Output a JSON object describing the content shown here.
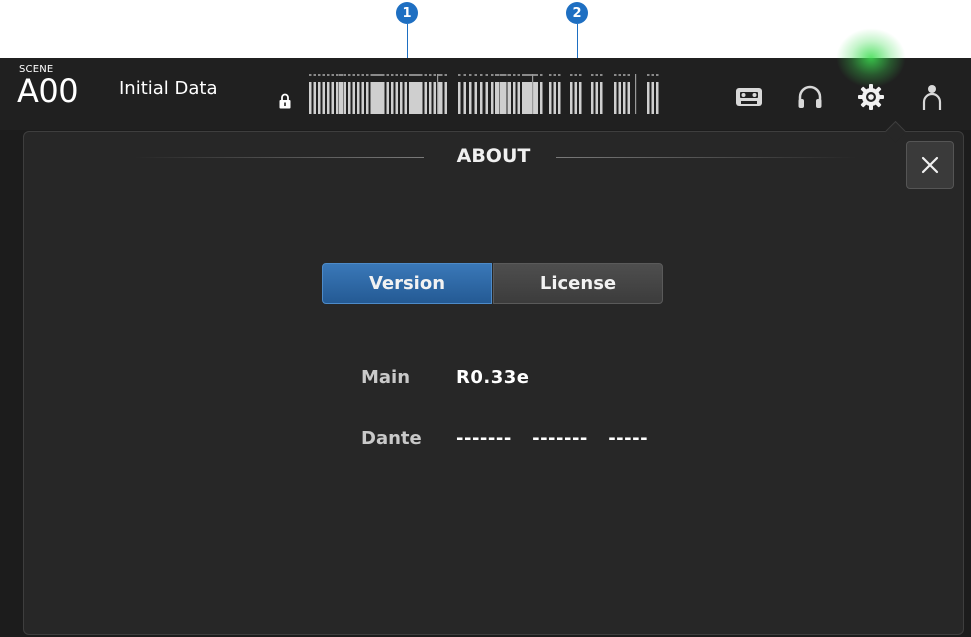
{
  "callouts": [
    "1",
    "2"
  ],
  "header": {
    "scene_label": "SCENE",
    "scene_number": "A00",
    "scene_name": "Initial Data"
  },
  "icons": {
    "lock": "lock-icon",
    "recorder": "recorder-icon",
    "headphones": "headphones-icon",
    "setup": "gear-icon",
    "user": "user-icon"
  },
  "dialog": {
    "title": "ABOUT",
    "close_label": "×",
    "tabs": [
      {
        "label": "Version",
        "active": true
      },
      {
        "label": "License",
        "active": false
      }
    ],
    "info": [
      {
        "label": "Main",
        "value": "R0.33e"
      },
      {
        "label": "Dante",
        "value": "-------   -------   -----"
      }
    ]
  },
  "colors": {
    "accent": "#2e6aa8",
    "glow": "#3cdc50",
    "background": "#1c1c1c"
  }
}
